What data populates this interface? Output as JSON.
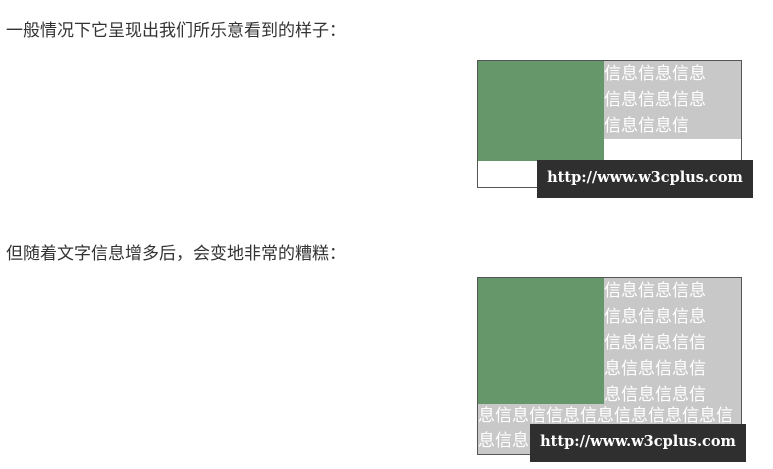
{
  "paragraphs": {
    "first": "一般情况下它呈现出我们所乐意看到的样子：",
    "second": "但随着文字信息增多后，会变地非常的糟糕："
  },
  "demo_normal": {
    "text_lines": [
      "信息信息信息",
      "信息信息信息",
      "信息信息信"
    ],
    "watermark": "http://www.w3cplus.com"
  },
  "demo_overflow": {
    "text_lines": [
      "信息信息信息",
      "信息信息信息",
      "信息信息信信",
      "息信息信息信",
      "息信息信息信"
    ],
    "full_lines": [
      "息信息信信息信息信息信息信息信",
      "息信息信息"
    ],
    "watermark": "http://www.w3cplus.com"
  },
  "colors": {
    "text": "#333333",
    "green_block": "#65976a",
    "text_background": "#c8c8c8",
    "watermark_background": "#2f2f2f"
  }
}
